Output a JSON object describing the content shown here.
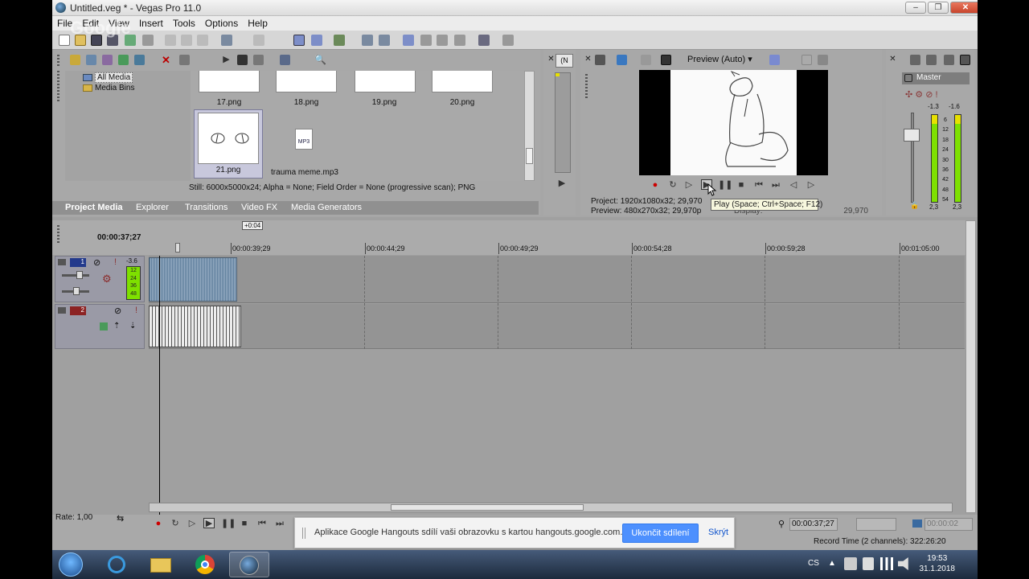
{
  "window": {
    "title": "Untitled.veg * - Vegas Pro 11.0"
  },
  "menu": [
    "File",
    "Edit",
    "View",
    "Insert",
    "Tools",
    "Options",
    "Help"
  ],
  "watermark": "Google",
  "explorer": {
    "tree": [
      {
        "label": "All Media"
      },
      {
        "label": "Media Bins"
      }
    ],
    "media": [
      {
        "label": "17.png"
      },
      {
        "label": "18.png"
      },
      {
        "label": "19.png"
      },
      {
        "label": "20.png"
      },
      {
        "label": "21.png"
      },
      {
        "label": "trauma meme.mp3",
        "badge": "MP3"
      }
    ],
    "status": "Still: 6000x5000x24; Alpha = None; Field Order = None (progressive scan); PNG",
    "tabs": [
      "Project Media",
      "Explorer",
      "Transitions",
      "Video FX",
      "Media Generators"
    ],
    "trimmer_label": "(N"
  },
  "preview": {
    "mode": "Preview (Auto)",
    "project_label": "Project:",
    "project_value": "1920x1080x32; 29,970",
    "preview_label": "Preview:",
    "preview_value": "480x270x32; 29,970p",
    "display_label": "Display:",
    "display_value": "29,970",
    "tooltip": "Play (Space; Ctrl+Space; F12)"
  },
  "mixer": {
    "title": "Master",
    "peak_left": "-1.3",
    "peak_right": "-1.6",
    "scale": [
      "6",
      "12",
      "18",
      "24",
      "30",
      "36",
      "42",
      "48",
      "54"
    ],
    "bottom_left": "2,3",
    "bottom_right": "2,3"
  },
  "timeline": {
    "cursor_time": "00:00:37;27",
    "marker": "+0:04",
    "ruler": [
      "00:00:39;29",
      "00:00:44;29",
      "00:00:49;29",
      "00:00:54;28",
      "00:00:59;28",
      "00:01:05:00"
    ],
    "tracks": [
      {
        "number": "1",
        "level": "-3.6",
        "meter": [
          "12",
          "24",
          "36",
          "48"
        ]
      },
      {
        "number": "2"
      }
    ],
    "rate": "Rate: 1,00"
  },
  "bottom": {
    "time": "00:00:37;27",
    "time_right": "00:00:02",
    "record_time": "Record Time (2 channels): 322:26:20"
  },
  "hangouts": {
    "message": "Aplikace Google Hangouts sdílí vaši obrazovku s kartou hangouts.google.com.",
    "stop": "Ukončit sdílení",
    "hide": "Skrýt"
  },
  "taskbar": {
    "language": "CS",
    "time": "19:53",
    "date": "31.1.2018"
  }
}
